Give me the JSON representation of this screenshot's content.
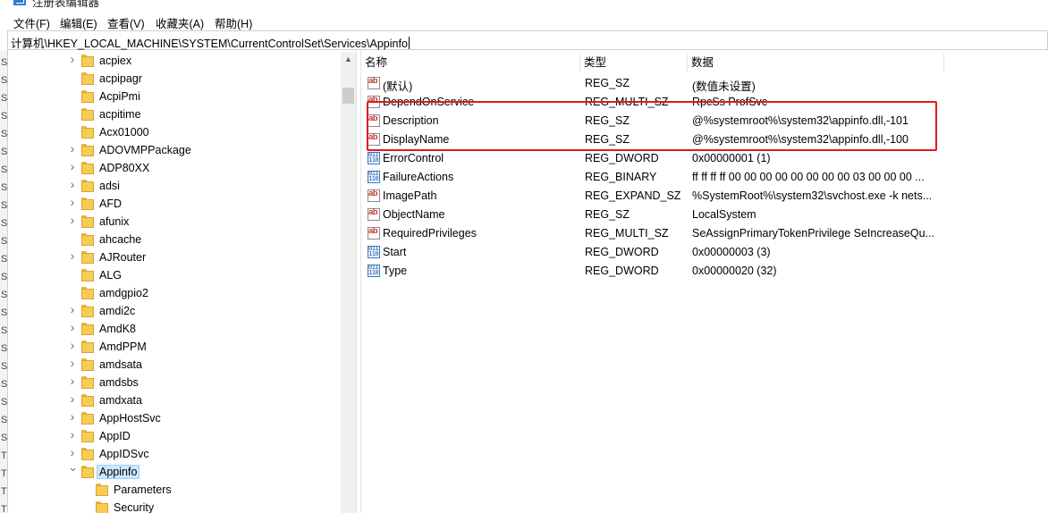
{
  "window": {
    "title": "注册表编辑器"
  },
  "menu": {
    "items": [
      "文件(F)",
      "编辑(E)",
      "查看(V)",
      "收藏夹(A)",
      "帮助(H)"
    ]
  },
  "address": {
    "path": "计算机\\HKEY_LOCAL_MACHINE\\SYSTEM\\CurrentControlSet\\Services\\Appinfo"
  },
  "leftstrip": {
    "chars": [
      "S",
      "S",
      "S",
      "S",
      "S",
      "S",
      "S",
      "S",
      "S",
      "S",
      "S",
      "S",
      "S",
      "S",
      "S",
      "S",
      "S",
      "S",
      "S",
      "S",
      "S",
      "S",
      "T",
      "T",
      "T",
      "T"
    ]
  },
  "tree": {
    "items": [
      {
        "label": "acpiex",
        "expandable": true,
        "level": 0
      },
      {
        "label": "acpipagr",
        "expandable": false,
        "level": 0
      },
      {
        "label": "AcpiPmi",
        "expandable": false,
        "level": 0
      },
      {
        "label": "acpitime",
        "expandable": false,
        "level": 0
      },
      {
        "label": "Acx01000",
        "expandable": false,
        "level": 0
      },
      {
        "label": "ADOVMPPackage",
        "expandable": true,
        "level": 0
      },
      {
        "label": "ADP80XX",
        "expandable": true,
        "level": 0
      },
      {
        "label": "adsi",
        "expandable": true,
        "level": 0
      },
      {
        "label": "AFD",
        "expandable": true,
        "level": 0
      },
      {
        "label": "afunix",
        "expandable": true,
        "level": 0
      },
      {
        "label": "ahcache",
        "expandable": false,
        "level": 0
      },
      {
        "label": "AJRouter",
        "expandable": true,
        "level": 0
      },
      {
        "label": "ALG",
        "expandable": false,
        "level": 0
      },
      {
        "label": "amdgpio2",
        "expandable": false,
        "level": 0
      },
      {
        "label": "amdi2c",
        "expandable": true,
        "level": 0
      },
      {
        "label": "AmdK8",
        "expandable": true,
        "level": 0
      },
      {
        "label": "AmdPPM",
        "expandable": true,
        "level": 0
      },
      {
        "label": "amdsata",
        "expandable": true,
        "level": 0
      },
      {
        "label": "amdsbs",
        "expandable": true,
        "level": 0
      },
      {
        "label": "amdxata",
        "expandable": true,
        "level": 0
      },
      {
        "label": "AppHostSvc",
        "expandable": true,
        "level": 0
      },
      {
        "label": "AppID",
        "expandable": true,
        "level": 0
      },
      {
        "label": "AppIDSvc",
        "expandable": true,
        "level": 0
      },
      {
        "label": "Appinfo",
        "expandable": true,
        "expanded": true,
        "selected": true,
        "level": 0
      },
      {
        "label": "Parameters",
        "expandable": false,
        "level": 1
      },
      {
        "label": "Security",
        "expandable": false,
        "level": 1
      }
    ]
  },
  "list": {
    "columns": [
      "名称",
      "类型",
      "数据"
    ],
    "rows": [
      {
        "name": "(默认)",
        "type": "REG_SZ",
        "data": "(数值未设置)",
        "icon": "string"
      },
      {
        "name": "DependOnService",
        "type": "REG_MULTI_SZ",
        "data": "RpcSs ProfSvc",
        "icon": "string"
      },
      {
        "name": "Description",
        "type": "REG_SZ",
        "data": "@%systemroot%\\system32\\appinfo.dll,-101",
        "icon": "string"
      },
      {
        "name": "DisplayName",
        "type": "REG_SZ",
        "data": "@%systemroot%\\system32\\appinfo.dll,-100",
        "icon": "string"
      },
      {
        "name": "ErrorControl",
        "type": "REG_DWORD",
        "data": "0x00000001 (1)",
        "icon": "binary"
      },
      {
        "name": "FailureActions",
        "type": "REG_BINARY",
        "data": "ff ff ff ff 00 00 00 00 00 00 00 00 03 00 00 00 ...",
        "icon": "binary"
      },
      {
        "name": "ImagePath",
        "type": "REG_EXPAND_SZ",
        "data": "%SystemRoot%\\system32\\svchost.exe -k nets...",
        "icon": "string"
      },
      {
        "name": "ObjectName",
        "type": "REG_SZ",
        "data": "LocalSystem",
        "icon": "string"
      },
      {
        "name": "RequiredPrivileges",
        "type": "REG_MULTI_SZ",
        "data": "SeAssignPrimaryTokenPrivilege SeIncreaseQu...",
        "icon": "string"
      },
      {
        "name": "Start",
        "type": "REG_DWORD",
        "data": "0x00000003 (3)",
        "icon": "binary"
      },
      {
        "name": "Type",
        "type": "REG_DWORD",
        "data": "0x00000020 (32)",
        "icon": "binary"
      }
    ]
  },
  "colors": {
    "highlight": "#e0191e",
    "selection": "#cce8ff",
    "folder": "#f5cd55"
  }
}
